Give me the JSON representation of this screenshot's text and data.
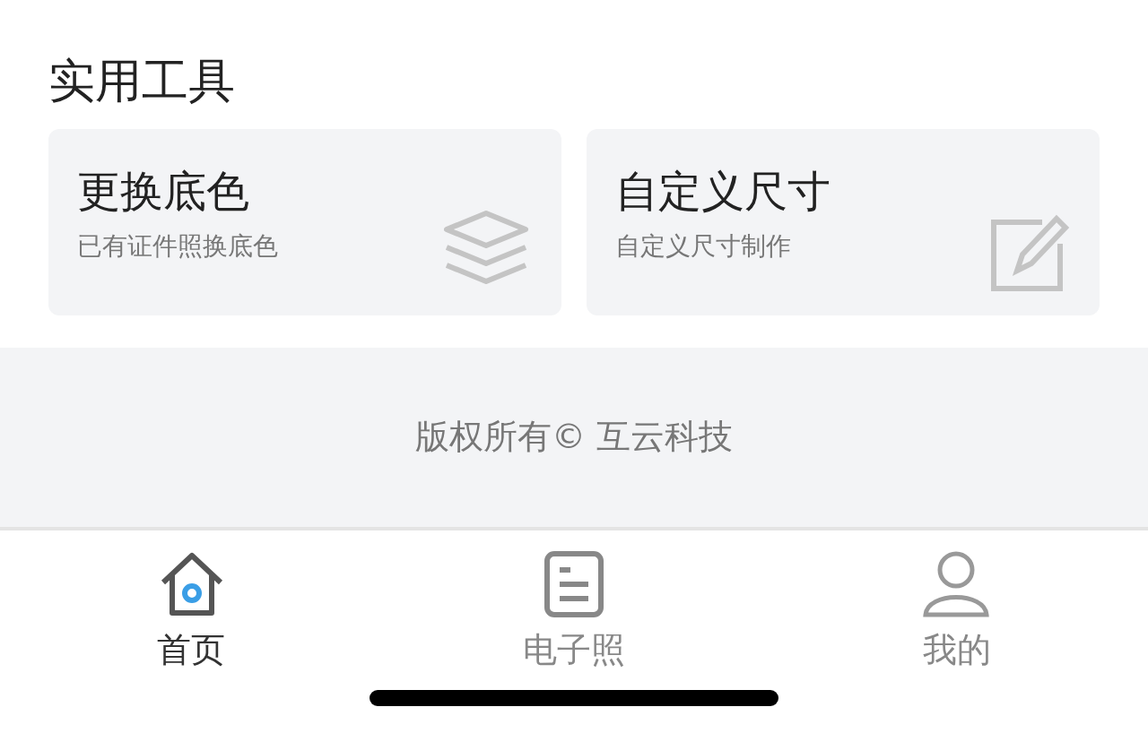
{
  "section_title": "实用工具",
  "tools": [
    {
      "title": "更换底色",
      "subtitle": "已有证件照换底色",
      "kind": "layers"
    },
    {
      "title": "自定义尺寸",
      "subtitle": "自定义尺寸制作",
      "kind": "edit"
    }
  ],
  "footer": {
    "copyright": "版权所有© 互云科技"
  },
  "tabs": [
    {
      "label": "首页",
      "kind": "home",
      "selected": true
    },
    {
      "label": "电子照",
      "kind": "document",
      "selected": false
    },
    {
      "label": "我的",
      "kind": "person",
      "selected": false
    }
  ]
}
